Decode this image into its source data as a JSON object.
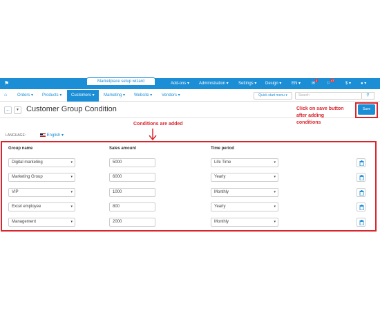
{
  "wizard_tab": "Marketplace setup wizard",
  "topbar": {
    "menus": [
      "Add-ons ▾",
      "Administration ▾",
      "Settings ▾",
      "Design ▾",
      "EN ▾",
      "$ ▾"
    ],
    "badges": [
      "2",
      "47"
    ]
  },
  "nav": {
    "items": [
      "Orders ▾",
      "Products ▾",
      "Customers ▾",
      "Marketing ▾",
      "Website ▾",
      "Vendors ▾"
    ],
    "active_index": 2,
    "quick_start": "Quick start menu ▾",
    "search_placeholder": "Search"
  },
  "page": {
    "title": "Customer Group Condition",
    "save_label": "Save"
  },
  "annotations": {
    "save_line1": "Click on save button",
    "save_line2": "after adding",
    "save_line3": "conditions",
    "conditions": "Conditions are added"
  },
  "language": {
    "label": "LANGUAGE:",
    "value": "English ▾"
  },
  "table": {
    "headers": [
      "Group name",
      "Sales amount",
      "Time period"
    ],
    "rows": [
      {
        "group": "Digital marketing",
        "amount": "5000",
        "period": "Life Time"
      },
      {
        "group": "Marketing Group",
        "amount": "6000",
        "period": "Yearly"
      },
      {
        "group": "VIP",
        "amount": "1000",
        "period": "Monthly"
      },
      {
        "group": "Excel employee",
        "amount": "800",
        "period": "Yearly"
      },
      {
        "group": "Management",
        "amount": "2000",
        "period": "Monthly"
      }
    ]
  },
  "colors": {
    "brand": "#1b8ed6",
    "annotation": "#d7262d"
  }
}
